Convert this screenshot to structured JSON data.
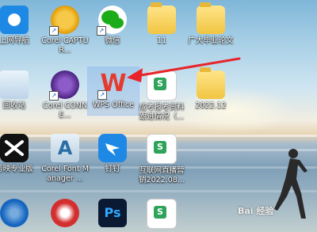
{
  "desktop": {
    "icons": [
      {
        "label": "上网导航",
        "icon": "ie-icon"
      },
      {
        "label": "Corel CAPTUR...",
        "icon": "corel-capture-icon"
      },
      {
        "label": "微信",
        "icon": "wechat-icon"
      },
      {
        "label": "11",
        "icon": "folder-icon"
      },
      {
        "label": "广大毕业论文",
        "icon": "folder-icon"
      },
      {
        "label": "回收站",
        "icon": "recycle-bin-icon"
      },
      {
        "label": "Corel CONNE...",
        "icon": "corel-connect-icon"
      },
      {
        "label": "WPS Office",
        "icon": "wps-office-icon"
      },
      {
        "label": "成考报考资料跟进情况（...",
        "icon": "spreadsheet-icon"
      },
      {
        "label": "2022.12",
        "icon": "folder-icon"
      },
      {
        "label": "剪映专业版",
        "icon": "capcut-icon"
      },
      {
        "label": "Corel Font Manager ...",
        "icon": "corel-font-manager-icon"
      },
      {
        "label": "钉钉",
        "icon": "dingtalk-icon"
      },
      {
        "label": "互联网直播营销2022.08...",
        "icon": "spreadsheet-icon"
      },
      {
        "label": "",
        "icon": "blue-app-icon"
      },
      {
        "label": "",
        "icon": "red-app-icon"
      },
      {
        "label": "",
        "icon": "photoshop-icon"
      },
      {
        "label": "",
        "icon": "spreadsheet-icon"
      }
    ],
    "wps_letter": "W",
    "ps_letters": "Ps",
    "sheet_letter": "S",
    "corel_font_letter": "A",
    "watermark": "Bai 经验",
    "arrow_color": "#e8242a"
  }
}
